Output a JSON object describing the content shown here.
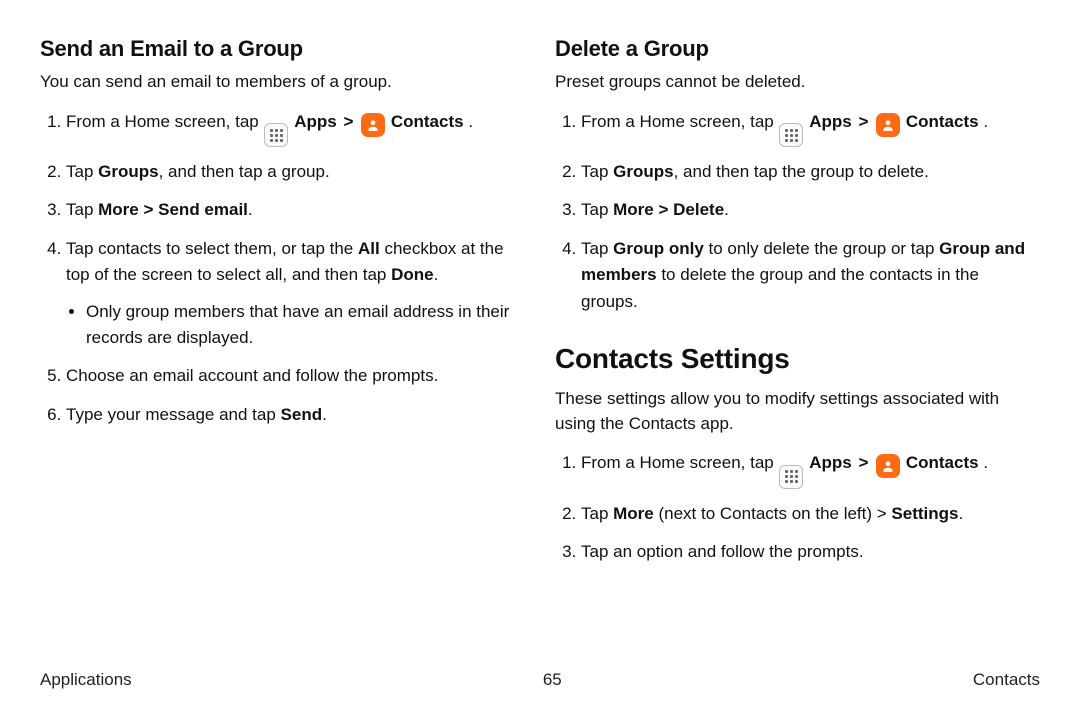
{
  "left": {
    "email": {
      "title": "Send an Email to a Group",
      "intro": "You can send an email to members of a group.",
      "step1_pre": "From a Home screen, tap ",
      "apps_label": "Apps",
      "chev": ">",
      "contacts_label": "Contacts",
      "step1_post": " .",
      "step2_pre": "Tap ",
      "step2_b": "Groups",
      "step2_post": ", and then tap a group.",
      "step3_pre": "Tap ",
      "step3_b1": "More",
      "step3_mid": " > ",
      "step3_b2": "Send email",
      "step3_post": ".",
      "step4_pre": "Tap contacts to select them, or tap the ",
      "step4_b1": "All",
      "step4_mid": " checkbox at the top of the screen to select all, and then tap ",
      "step4_b2": "Done",
      "step4_post": ".",
      "step4_bullet": "Only group members that have an email address in their records are displayed.",
      "step5": "Choose an email account and follow the prompts.",
      "step6_pre": "Type your message and tap ",
      "step6_b": "Send",
      "step6_post": "."
    }
  },
  "right": {
    "delete": {
      "title": "Delete a Group",
      "intro": "Preset groups cannot be deleted.",
      "step1_pre": "From a Home screen, tap ",
      "apps_label": "Apps",
      "chev": ">",
      "contacts_label": "Contacts",
      "step1_post": " .",
      "step2_pre": "Tap ",
      "step2_b": "Groups",
      "step2_post": ", and then tap the group to delete.",
      "step3_pre": "Tap ",
      "step3_b1": "More",
      "step3_mid": " > ",
      "step3_b2": "Delete",
      "step3_post": ".",
      "step4_pre": "Tap ",
      "step4_b1": "Group only",
      "step4_mid": " to only delete the group or tap ",
      "step4_b2": "Group and members",
      "step4_post": " to delete the group and the contacts in the groups."
    },
    "settings": {
      "title": "Contacts Settings",
      "intro": "These settings allow you to modify settings associated with using the Contacts app.",
      "step1_pre": "From a Home screen, tap ",
      "apps_label": "Apps",
      "chev": ">",
      "contacts_label": "Contacts",
      "step1_post": ".",
      "step2_pre": "Tap ",
      "step2_b1": "More",
      "step2_mid": " (next to Contacts on the left) > ",
      "step2_b2": "Settings",
      "step2_post": ".",
      "step3": "Tap an option and follow the prompts."
    }
  },
  "footer": {
    "left": "Applications",
    "center": "65",
    "right": "Contacts"
  }
}
